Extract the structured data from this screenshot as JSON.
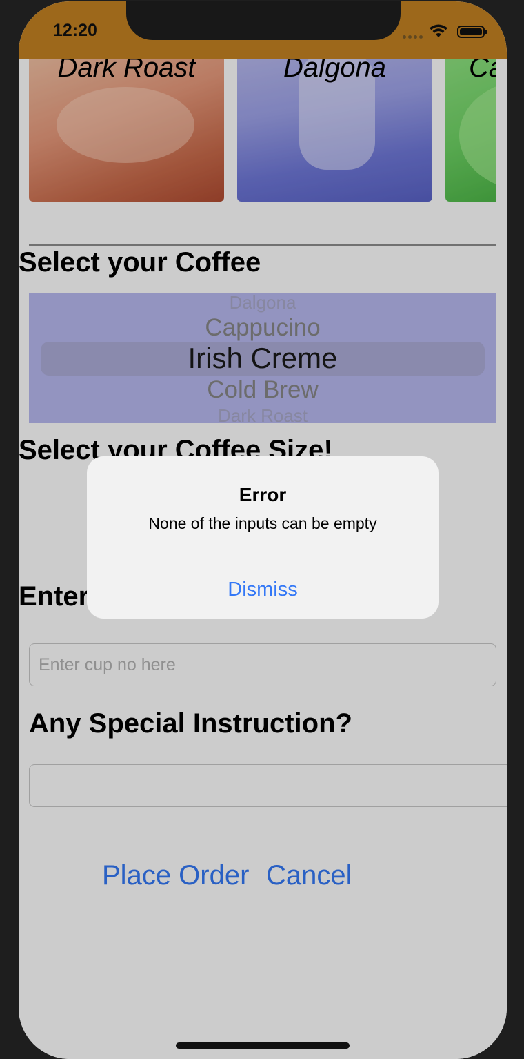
{
  "status_bar": {
    "time": "12:20"
  },
  "carousel": {
    "items": [
      {
        "label": "Dark Roast"
      },
      {
        "label": "Dalgona"
      },
      {
        "label": "Ca"
      }
    ]
  },
  "sections": {
    "coffee_title": "Select your Coffee",
    "size_title": "Select your Coffee Size!",
    "cups_title": "Enter",
    "instructions_title": "Any Special Instruction?"
  },
  "picker": {
    "options_above": [
      "Dalgona",
      "Cappucino"
    ],
    "selected": "Irish Creme",
    "options_below": [
      "Cold Brew",
      "Dark Roast"
    ]
  },
  "cups_input": {
    "placeholder": "Enter cup no here",
    "value": ""
  },
  "instructions_input": {
    "value": ""
  },
  "actions": {
    "place_order": "Place Order",
    "cancel": "Cancel"
  },
  "alert": {
    "title": "Error",
    "message": "None of the inputs can be empty",
    "dismiss": "Dismiss"
  },
  "colors": {
    "status_bar": "#c58222",
    "accent": "#3478f6",
    "picker_bg": "#b8b9f0"
  }
}
